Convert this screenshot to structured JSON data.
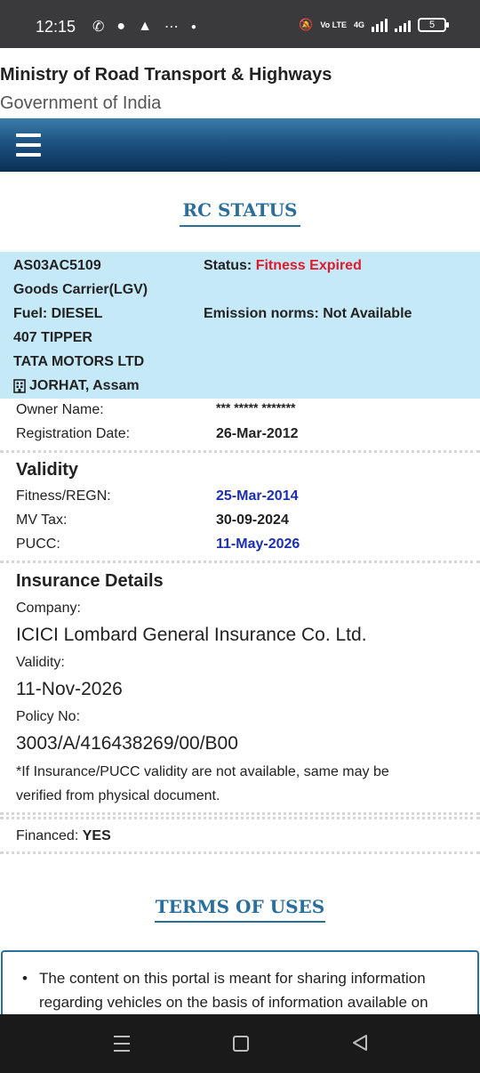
{
  "status_bar": {
    "time": "12:15",
    "battery": "5",
    "network": "4G",
    "volte": "Vo LTE"
  },
  "header": {
    "title": "Ministry of Road Transport & Highways",
    "subtitle": "Government of India"
  },
  "rc_status": {
    "heading": "RC STATUS"
  },
  "vehicle": {
    "reg_no": "AS03AC5109",
    "status_label": "Status:",
    "status_value": "Fitness Expired",
    "class": "Goods Carrier(LGV)",
    "fuel": "Fuel: DIESEL",
    "emission": "Emission norms: Not Available",
    "model": "407 TIPPER",
    "maker": "TATA MOTORS LTD",
    "rto": "JORHAT, Assam"
  },
  "owner": {
    "owner_label": "Owner Name:",
    "owner_value": "*** ***** *******",
    "reg_date_label": "Registration Date:",
    "reg_date_value": "26-Mar-2012"
  },
  "validity": {
    "title": "Validity",
    "fitness_label": "Fitness/REGN:",
    "fitness_value": "25-Mar-2014",
    "mvtax_label": "MV Tax:",
    "mvtax_value": "30-09-2024",
    "pucc_label": "PUCC:",
    "pucc_value": "11-May-2026"
  },
  "insurance": {
    "title": "Insurance Details",
    "company_label": "Company:",
    "company_value": "ICICI Lombard General Insurance Co. Ltd.",
    "validity_label": "Validity:",
    "validity_value": "11-Nov-2026",
    "policy_label": "Policy No:",
    "policy_value": "3003/A/416438269/00/B00",
    "note_line1": "*If Insurance/PUCC validity are not available, same may be",
    "note_line2": "verified from physical document."
  },
  "financed": {
    "label": "Financed:",
    "value": "YES"
  },
  "terms": {
    "heading": "TERMS OF USES",
    "item1_line1": "The content on this portal is meant for sharing information",
    "item1_line2": "regarding vehicles on the basis of information available on"
  },
  "colors": {
    "accent": "#2a6f9b",
    "status_red": "#e2182b",
    "date_blue": "#1c2fb0",
    "info_bg": "#c6e9f8",
    "nav_dark": "#0a2f55"
  }
}
